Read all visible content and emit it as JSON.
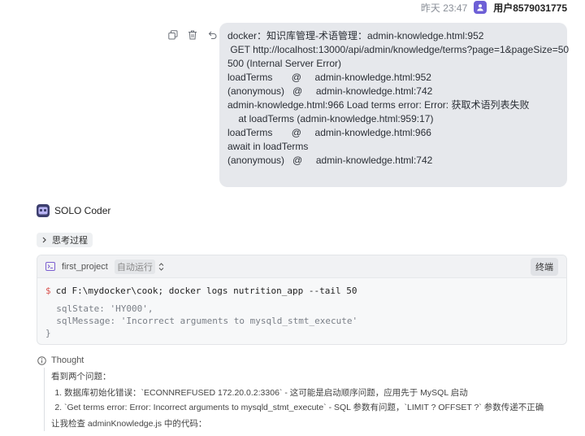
{
  "header": {
    "timestamp": "昨天 23:47",
    "user_name": "用户8579031775"
  },
  "user_message": {
    "lines": [
      "docker：知识库管理-术语管理：admin-knowledge.html:952",
      " GET http://localhost:13000/api/admin/knowledge/terms?page=1&pageSize=50",
      "500 (Internal Server Error)",
      "loadTerms       @     admin-knowledge.html:952",
      "(anonymous)   @     admin-knowledge.html:742",
      "",
      "admin-knowledge.html:966 Load terms error: Error: 获取术语列表失败",
      "    at loadTerms (admin-knowledge.html:959:17)",
      "loadTerms       @     admin-knowledge.html:966",
      "await in loadTerms",
      "(anonymous)   @     admin-knowledge.html:742"
    ]
  },
  "agent": {
    "name": "SOLO Coder",
    "thinking_label": "思考过程"
  },
  "terminal": {
    "project": "first_project",
    "mode": "自动运行",
    "stop_label": "终端",
    "prompt": "$",
    "command": "cd F:\\mydocker\\cook; docker logs nutrition_app --tail 50",
    "output": [
      "  sqlState: 'HY000',",
      "  sqlMessage: 'Incorrect arguments to mysqld_stmt_execute'",
      "}"
    ]
  },
  "thought": {
    "title": "Thought",
    "intro": "看到两个问题：",
    "items": [
      "数据库初始化错误：`ECONNREFUSED 172.20.0.2:3306` - 这可能是启动顺序问题，应用先于 MySQL 启动",
      "`Get terms error: Error: Incorrect arguments to mysqld_stmt_execute` - SQL 参数有问题，`LIMIT ? OFFSET ?` 参数传递不正确"
    ],
    "outro": "让我检查 adminKnowledge.js 中的代码："
  }
}
